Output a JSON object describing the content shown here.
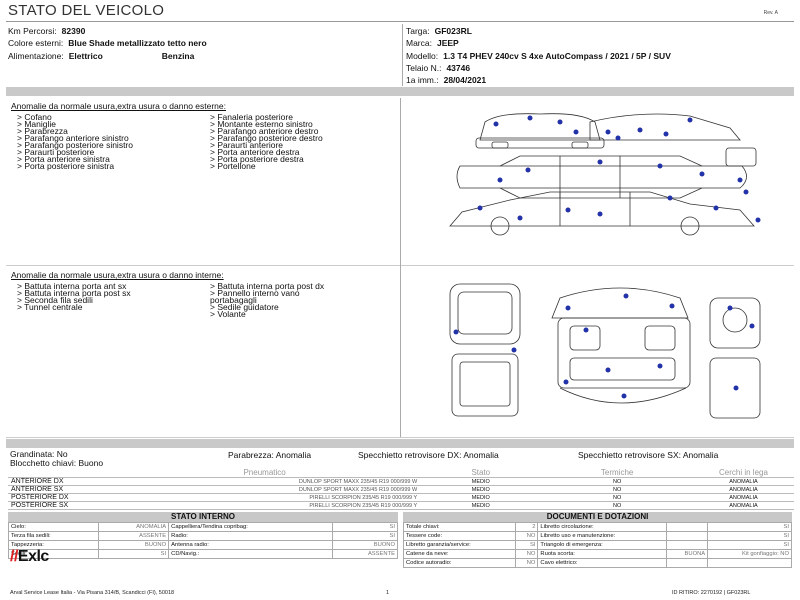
{
  "header": {
    "title": "STATO DEL VEICOLO",
    "rev": "Rev. A"
  },
  "vehicle_left": [
    {
      "label": "Km Percorsi:",
      "value": "82390"
    },
    {
      "label": "Colore esterni:",
      "value": "Blue Shade metallizzato tetto nero"
    },
    {
      "label": "Alimentazione:",
      "value": "Elettrico",
      "value2": "Benzina"
    }
  ],
  "vehicle_right": [
    {
      "label": "Targa:",
      "value": "GF023RL"
    },
    {
      "label": "Marca:",
      "value": "JEEP"
    },
    {
      "label": "Modello:",
      "value": "1.3 T4 PHEV 240cv S 4xe AutoCompass / 2021 / 5P / SUV"
    },
    {
      "label": "Telaio N.:",
      "value": "43746"
    },
    {
      "label": "1a imm.:",
      "value": "28/04/2021"
    }
  ],
  "external": {
    "title": "Anomalie da normale usura,extra usura o danno esterne:",
    "col1": [
      "> Cofano",
      "> Maniglie",
      "> Parabrezza",
      "> Parafango anteriore sinistro",
      "> Parafango posteriore sinistro",
      "> Paraurti posteriore",
      "> Porta anteriore sinistra",
      "> Porta posteriore sinistra"
    ],
    "col2": [
      "> Fanaleria posteriore",
      "> Montante esterno sinistro",
      "> Parafango anteriore destro",
      "> Parafango posteriore destro",
      "> Paraurti anteriore",
      "> Porta anteriore destra",
      "> Porta posteriore destra",
      "> Portellone"
    ]
  },
  "internal": {
    "title": "Anomalie da normale usura,extra usura o danno interne:",
    "col1": [
      "> Battuta interna porta ant sx",
      "> Battuta interna porta post sx",
      "> Seconda fila sedili",
      "> Tunnel centrale"
    ],
    "col2": [
      "> Battuta interna porta post dx",
      "> Pannello interno vano",
      "portabagagli",
      "> Sedile guidatore",
      "> Volante"
    ]
  },
  "status_line": {
    "grandinata": "Grandinata: No",
    "parabrezza": "Parabrezza: Anomalia",
    "specchietto_dx": "Specchietto retrovisore DX: Anomalia",
    "specchietto_sx": "Specchietto retrovisore SX: Anomalia",
    "blocchetto": "Blocchetto chiavi: Buono"
  },
  "tyres": {
    "headers": [
      "Pneumatico",
      "Stato",
      "Termiche",
      "Cerchi in lega"
    ],
    "rows": [
      {
        "pos": "ANTERIORE DX",
        "tyre": "DUNLOP SPORT MAXX 235/45 R19 000/999 W",
        "stato": "MEDIO",
        "term": "NO",
        "cerchi": "ANOMALIA"
      },
      {
        "pos": "ANTERIORE SX",
        "tyre": "DUNLOP SPORT MAXX 235/45 R19 000/999 W",
        "stato": "MEDIO",
        "term": "NO",
        "cerchi": "ANOMALIA"
      },
      {
        "pos": "POSTERIORE DX",
        "tyre": "PIRELLI SCORPION 235/45 R19 000/999 Y",
        "stato": "MEDIO",
        "term": "NO",
        "cerchi": "ANOMALIA"
      },
      {
        "pos": "POSTERIORE SX",
        "tyre": "PIRELLI SCORPION 235/45 R19 000/999 Y",
        "stato": "MEDIO",
        "term": "NO",
        "cerchi": "ANOMALIA"
      }
    ]
  },
  "stato_interno": {
    "title": "STATO INTERNO",
    "rows": [
      [
        "Cielo:",
        "ANOMALIA",
        "Cappelliera/Tendina copribag:",
        "SI"
      ],
      [
        "Terza fila sedili:",
        "ASSENTE",
        "Radio:",
        "SI"
      ],
      [
        "Tappezzeria:",
        "BUONO",
        "Antenna radio:",
        "BUONO"
      ],
      [
        "Sedili:",
        "SI",
        "CD/Navig.:",
        "ASSENTE"
      ]
    ]
  },
  "documenti": {
    "title": "DOCUMENTI E DOTAZIONI",
    "rows": [
      [
        "Totale chiavi:",
        "2",
        "Libretto circolazione:",
        "",
        "SI"
      ],
      [
        "Tessere code:",
        "NO",
        "Libretto uso e manutenzione:",
        "",
        "SI"
      ],
      [
        "Libretto garanzia/service:",
        "SI",
        "Triangolo di emergenza:",
        "",
        "SI"
      ],
      [
        "Catene da neve:",
        "NO",
        "Ruota scorta:",
        "BUONA",
        "Kit gonfiaggio: NO"
      ],
      [
        "Codice autoradio:",
        "NO",
        "Cavo elettrico:",
        "",
        ""
      ]
    ]
  },
  "footer": {
    "logo": "Exlc",
    "address": "Arval Service Lease Italia - Via Pisana 314/B, Scandicci (FI), 50018",
    "page": "1",
    "ritiro": "ID RITIRO: 2270192 | GF023RL"
  }
}
